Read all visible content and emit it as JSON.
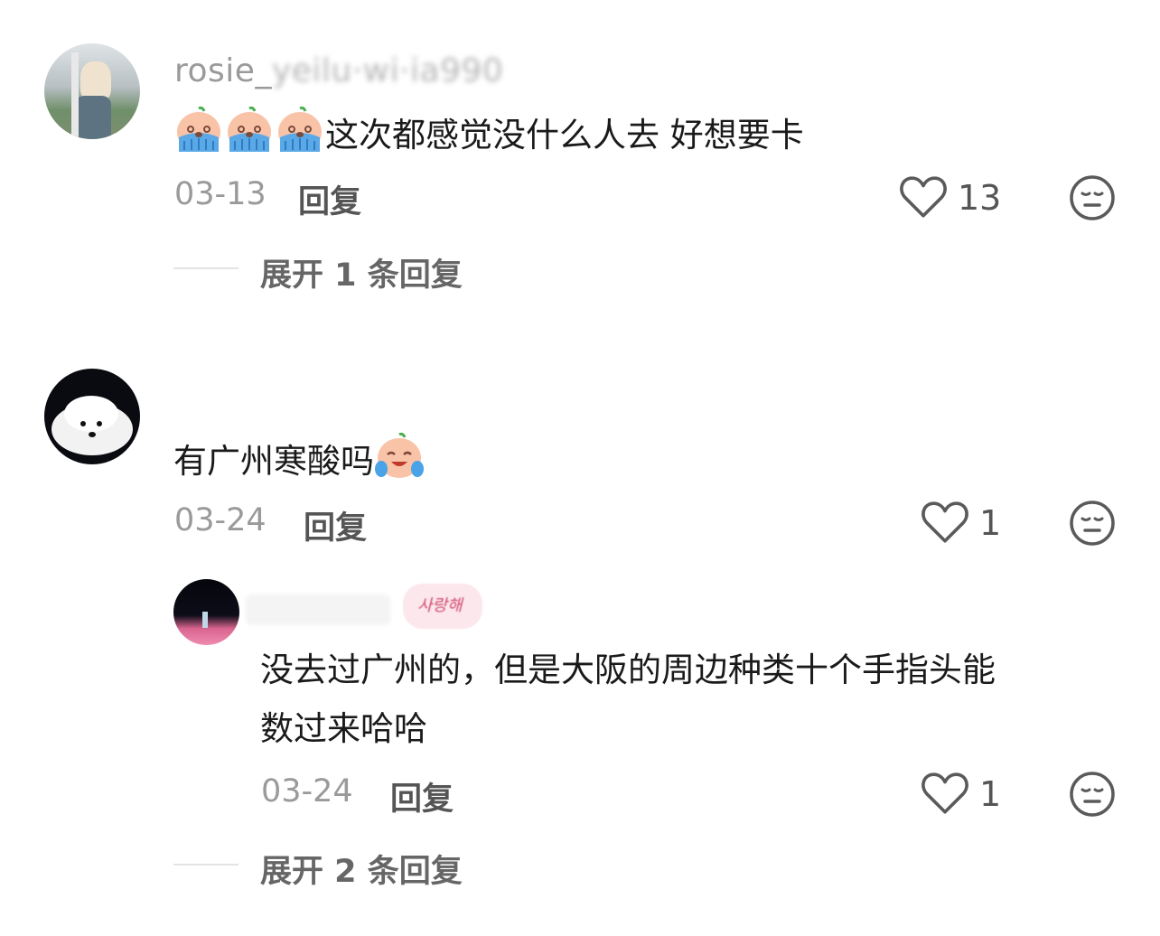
{
  "comments": [
    {
      "username": "rosie_yeilu·wi·ia990",
      "text": "这次都感觉没什么人去 好想要卡",
      "emojis": [
        "crying-face-emoji",
        "crying-face-emoji",
        "crying-face-emoji"
      ],
      "date": "03-13",
      "reply_label": "回复",
      "likes": "13",
      "expand_label": "展开 1 条回复"
    },
    {
      "text": "有广州寒酸吗",
      "emojis": [
        "laugh-cry-emoji"
      ],
      "date": "03-24",
      "reply_label": "回复",
      "likes": "1",
      "replies": [
        {
          "badge": "사랑해",
          "text_line1": "没去过广州的，但是大阪的周边种类十个手指头能",
          "text_line2": "数过来哈哈",
          "date": "03-24",
          "reply_label": "回复",
          "likes": "1"
        }
      ],
      "expand_label": "展开 2 条回复"
    }
  ],
  "colors": {
    "meta": "#9a9a9a",
    "text": "#1a1a1a",
    "icon": "#5a5a5a"
  }
}
